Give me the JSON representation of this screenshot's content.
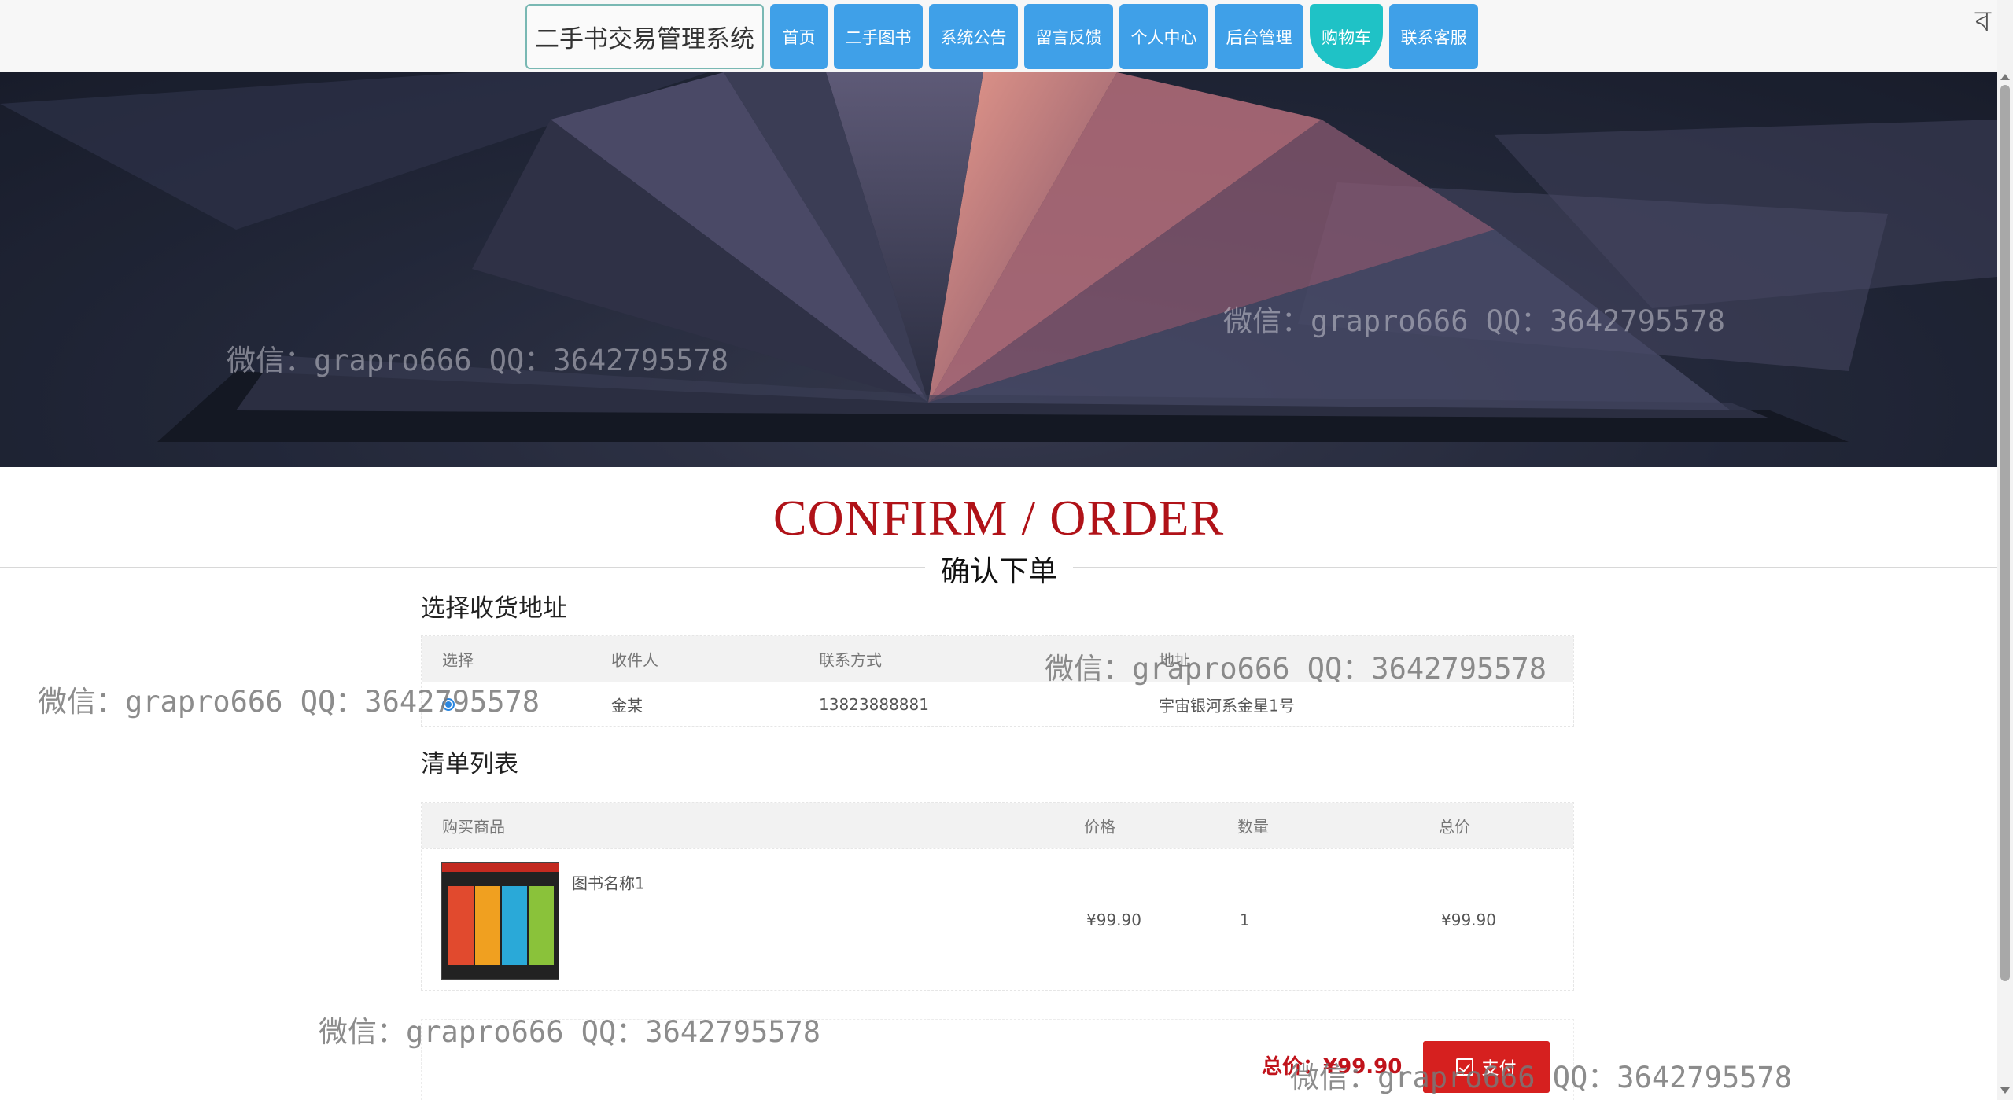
{
  "nav": {
    "brand": "二手书交易管理系统",
    "items": [
      {
        "label": "首页",
        "width": 73
      },
      {
        "label": "二手图书",
        "width": 113
      },
      {
        "label": "系统公告",
        "width": 113
      },
      {
        "label": "留言反馈",
        "width": 113
      },
      {
        "label": "个人中心",
        "width": 113
      },
      {
        "label": "后台管理",
        "width": 113
      },
      {
        "label": "购物车",
        "width": 93,
        "active": true
      },
      {
        "label": "联系客服",
        "width": 113
      }
    ],
    "corner_text": "ব"
  },
  "heading": {
    "en": "CONFIRM / ORDER",
    "cn": "确认下单"
  },
  "address_section": {
    "title": "选择收货地址",
    "columns": [
      "选择",
      "收件人",
      "联系方式",
      "地址"
    ],
    "rows": [
      {
        "recipient": "金某",
        "phone": "13823888881",
        "address": "宇宙银河系金星1号",
        "selected": true
      }
    ]
  },
  "cart_section": {
    "title": "清单列表",
    "columns": [
      "购买商品",
      "价格",
      "数量",
      "总价"
    ],
    "rows": [
      {
        "name": "图书名称1",
        "price": "¥99.90",
        "qty": "1",
        "subtotal": "¥99.90",
        "image_icon": "book-cover-thumbnail"
      }
    ]
  },
  "summary": {
    "total_label": "总价：",
    "total_value": "¥99.90",
    "pay_label": "支付",
    "pay_icon": "checkbox-icon"
  },
  "watermark": "微信：grapro666 QQ：3642795578",
  "colors": {
    "nav_blue": "#3fa0e8",
    "nav_active": "#1fc2c6",
    "heading_red": "#b01218",
    "pay_red": "#d6201f"
  }
}
